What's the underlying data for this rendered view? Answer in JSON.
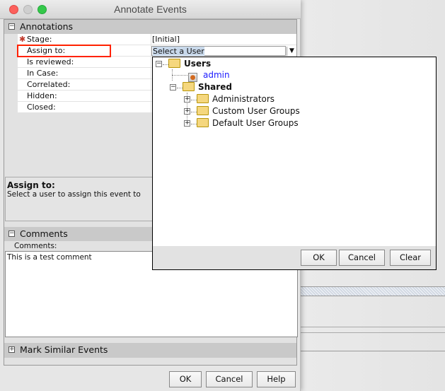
{
  "window": {
    "title": "Annotate Events"
  },
  "annotations": {
    "header": "Annotations",
    "rows": [
      {
        "label": "Stage:",
        "value": "[Initial]",
        "required": true
      },
      {
        "label": "Assign to:",
        "value": "Select a User",
        "highlighted": true
      },
      {
        "label": "Is reviewed:",
        "value": ""
      },
      {
        "label": "In Case:",
        "value": ""
      },
      {
        "label": "Correlated:",
        "value": ""
      },
      {
        "label": "Hidden:",
        "value": ""
      },
      {
        "label": "Closed:",
        "value": ""
      }
    ]
  },
  "description": {
    "title": "Assign to:",
    "text": "Select a user to assign this event to"
  },
  "comments": {
    "header": "Comments",
    "label": "Comments:",
    "value": "This is a test comment"
  },
  "mark_similar": {
    "header": "Mark Similar Events"
  },
  "footer": {
    "ok": "OK",
    "cancel": "Cancel",
    "help": "Help"
  },
  "popup": {
    "tree": {
      "users": "Users",
      "admin": "admin",
      "shared": "Shared",
      "groups": [
        "Administrators",
        "Custom User Groups",
        "Default User Groups"
      ]
    },
    "ok": "OK",
    "cancel": "Cancel",
    "clear": "Clear"
  },
  "colors": {
    "highlight": "#ff2200",
    "link": "#1a1aff",
    "required": "#c0392b"
  }
}
